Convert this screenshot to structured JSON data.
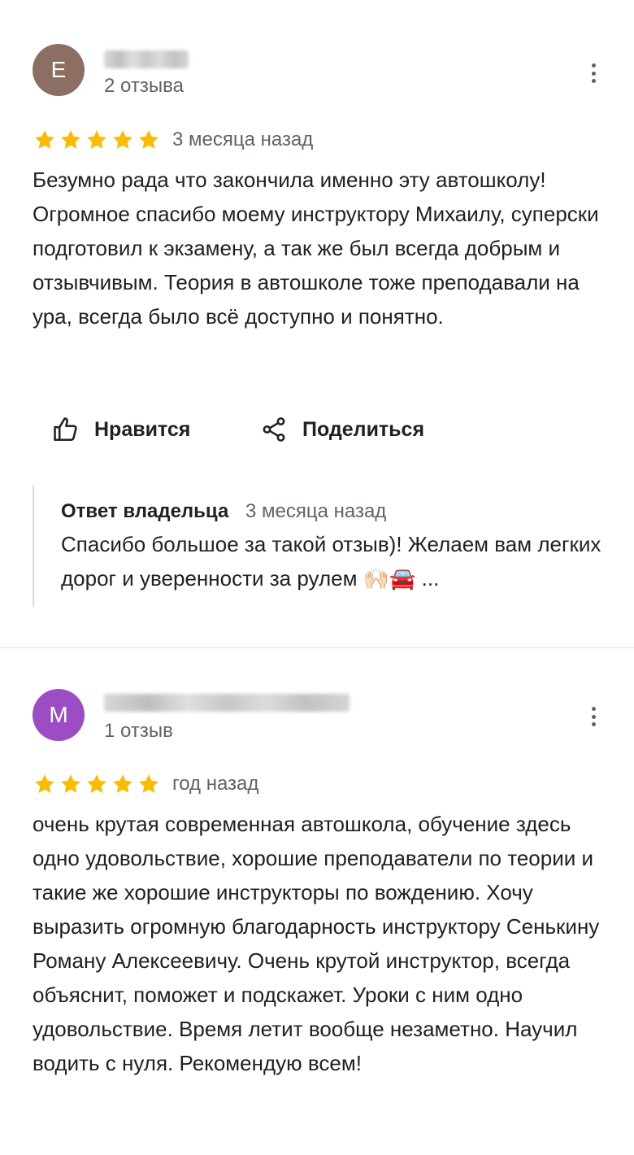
{
  "reviews": [
    {
      "avatar_letter": "E",
      "avatar_color": "#8d6e63",
      "review_count": "2 отзыва",
      "rating": 5,
      "date": "3 месяца назад",
      "text": "Безумно рада что закончила именно эту автошколу! Огромное спасибо моему инструктору Михаилу, суперски подготовил к экзамену, а так же был всегда добрым и отзывчивым. Теория в автошколе тоже преподавали на ура, всегда было всё доступно и понятно.",
      "like_label": "Нравится",
      "share_label": "Поделиться",
      "owner_reply": {
        "title": "Ответ владельца",
        "date": "3 месяца назад",
        "text": "Спасибо большое за такой отзыв)! Желаем вам легких дорог и уверенности за рулем 🙌🏻🚘 ..."
      }
    },
    {
      "avatar_letter": "M",
      "avatar_color": "#9c4dc4",
      "review_count": "1 отзыв",
      "rating": 5,
      "date": "год назад",
      "text": "очень крутая современная автошкола, обучение здесь одно удовольствие, хорошие преподаватели по теории и такие же хорошие инструкторы по вождению. Хочу выразить огромную благодарность инструктору Сенькину Роману Алексеевичу. Очень крутой инструктор, всегда объяснит, поможет и подскажет. Уроки с ним одно удовольствие. Время летит вообще незаметно. Научил водить с нуля. Рекомендую всем!"
    }
  ],
  "colors": {
    "star": "#fbbc04",
    "secondary_text": "#5f6368",
    "primary_text": "#202124"
  },
  "icons": {
    "menu": "more-vert-icon",
    "like": "thumb-up-icon",
    "share": "share-icon",
    "star": "star-icon"
  }
}
